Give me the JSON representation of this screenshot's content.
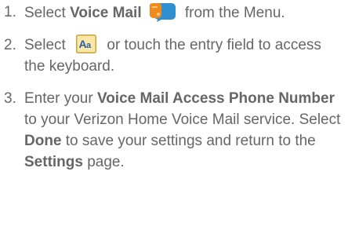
{
  "steps": [
    {
      "number": "1.",
      "pre": "Select ",
      "bold": "Voice Mail",
      "icon": "voice-mail-app-icon",
      "post": " from the Menu."
    },
    {
      "number": "2.",
      "pre": "Select ",
      "icon": "keyboard-aa-icon",
      "post": " or touch the entry field to access the keyboard."
    },
    {
      "number": "3.",
      "pre": "Enter your ",
      "bold1": "Voice Mail Access Phone Number",
      "mid1": " to your Verizon Home Voice Mail service. Select ",
      "bold2": "Done",
      "mid2": " to save your settings and return to the ",
      "bold3": "Settings",
      "post": " page."
    }
  ],
  "colors": {
    "text": "#666666",
    "voice_mail_icon_orange": "#f08a1c",
    "voice_mail_icon_blue": "#2f8fd0",
    "aa_icon_bg": "#fbe7a6",
    "aa_icon_border": "#c9a33b"
  }
}
